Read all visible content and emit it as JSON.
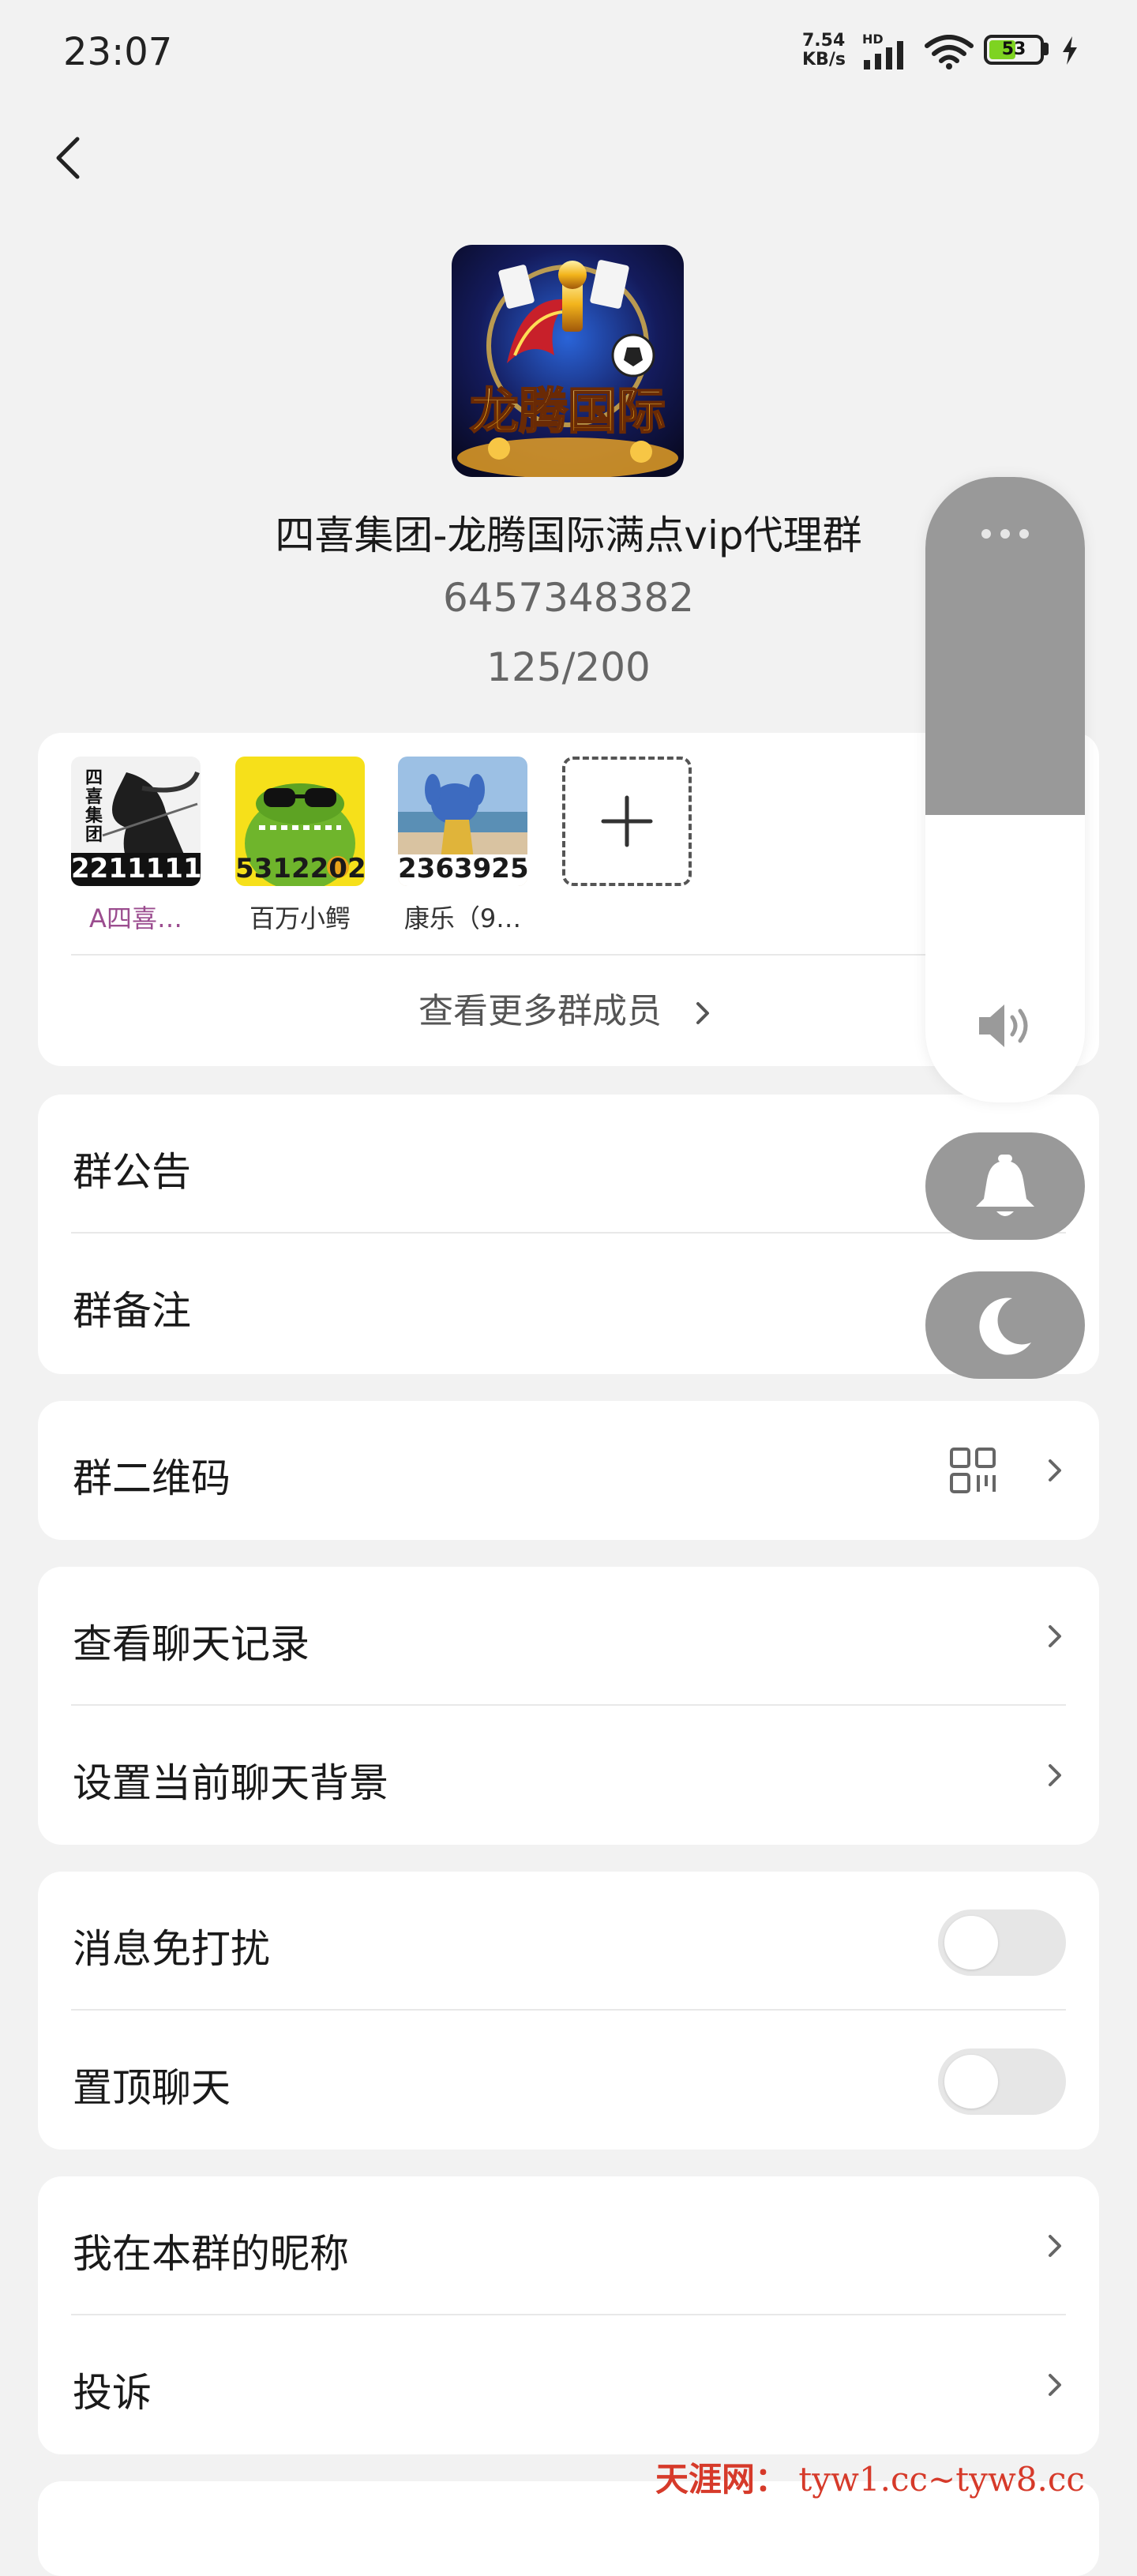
{
  "status_bar": {
    "time": "23:07",
    "net_speed_value": "7.54",
    "net_speed_unit": "KB/s",
    "network_type": "HD",
    "battery_level": "53"
  },
  "header": {
    "group_name": "四喜集团-龙腾国际满点vip代理群",
    "group_id": "6457348382",
    "member_count": "125/200",
    "avatar_text": "龙腾国际"
  },
  "members": {
    "items": [
      {
        "tag": "2211111",
        "label": "A四喜…",
        "label_color": "#9b4d8f",
        "tag_color": "#ffffff",
        "avatar_text": "四喜集团"
      },
      {
        "tag": "5312202",
        "label": "百万小鳄",
        "label_color": "#333333",
        "tag_color": "#1a1a1a"
      },
      {
        "tag": "2363925",
        "label": "康乐（9…",
        "label_color": "#333333",
        "tag_color": "#1a1a1a"
      }
    ],
    "more_label": "查看更多群成员"
  },
  "settings": {
    "notice": "群公告",
    "remark": "群备注",
    "qr_code": "群二维码",
    "chat_history": "查看聊天记录",
    "chat_background": "设置当前聊天背景",
    "mute": "消息免打扰",
    "mute_on": false,
    "pin": "置顶聊天",
    "pin_on": false,
    "my_nickname": "我在本群的昵称",
    "report": "投诉"
  },
  "volume_overlay": {
    "level_percent": 54,
    "icons": [
      "more-icon",
      "speaker-icon",
      "bell-icon",
      "moon-icon"
    ]
  },
  "watermark": {
    "site_name": "天涯网：",
    "urls": "tyw1.cc~tyw8.cc"
  }
}
